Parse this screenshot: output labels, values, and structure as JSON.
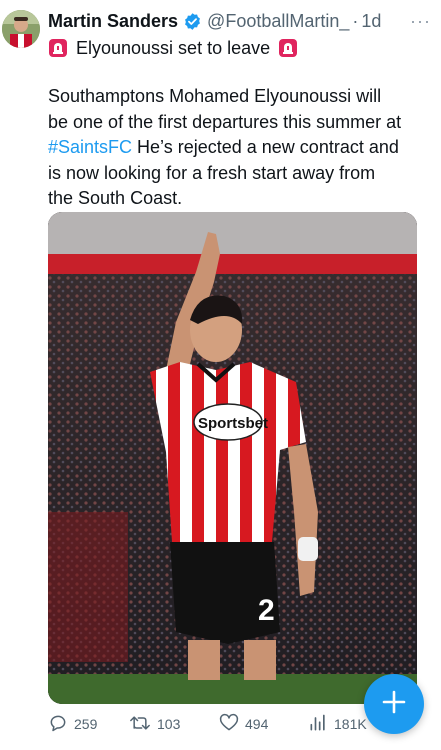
{
  "author": {
    "name": "Martin Sanders",
    "handle": "@FootballMartin_",
    "separator": "·",
    "time": "1d",
    "more_label": "···"
  },
  "tweet": {
    "headline": "Elyounoussi set to leave",
    "body_lines": [
      "Southamptons Mohamed Elyounoussi will",
      "be one of the first departures this summer at"
    ],
    "hashtag": "#SaintsFC",
    "line3_rest": " He’s rejected a new contract and",
    "body_lines_tail": [
      "is now looking for a fresh start away from",
      "the South Coast."
    ]
  },
  "media": {
    "sponsor_text": "Sportsbet",
    "shirt_number": "2"
  },
  "actions": {
    "reply_count": "259",
    "retweet_count": "103",
    "like_count": "494",
    "views_count": "181K"
  },
  "colors": {
    "accent": "#1d9bf0",
    "muted": "#536471",
    "siren": "#e0245e",
    "kit_red": "#d71920"
  },
  "icons": {
    "verified": "verified-badge-icon",
    "siren": "rotating-light-icon",
    "reply": "reply-icon",
    "retweet": "retweet-icon",
    "like": "heart-icon",
    "views": "views-chart-icon",
    "fab": "compose-plus-icon"
  }
}
